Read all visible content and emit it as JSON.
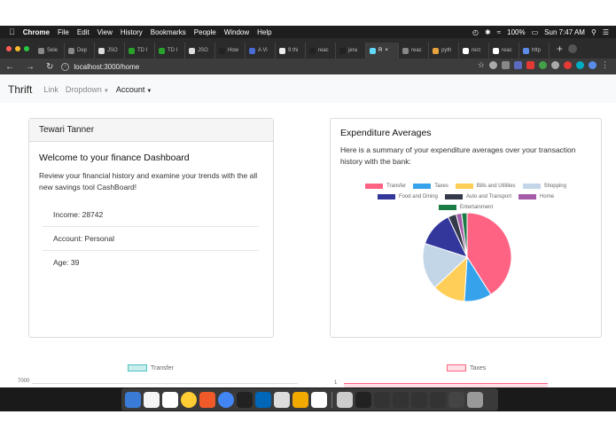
{
  "menubar": {
    "app": "Chrome",
    "items": [
      "File",
      "Edit",
      "View",
      "History",
      "Bookmarks",
      "People",
      "Window",
      "Help"
    ],
    "battery": "100%",
    "clock": "Sun 7:47 AM"
  },
  "tabs": [
    {
      "label": "Sele",
      "color": "#888888"
    },
    {
      "label": "Dep",
      "color": "#888888"
    },
    {
      "label": "JSO",
      "color": "#dddddd"
    },
    {
      "label": "TD I",
      "color": "#2aa12a"
    },
    {
      "label": "TD I",
      "color": "#2aa12a"
    },
    {
      "label": "JSO",
      "color": "#dddddd"
    },
    {
      "label": "How",
      "color": "#222222"
    },
    {
      "label": "A Vi",
      "color": "#4a6cd4"
    },
    {
      "label": "9 thi",
      "color": "#eeeeee"
    },
    {
      "label": "reac",
      "color": "#222222"
    },
    {
      "label": "jera",
      "color": "#222222"
    },
    {
      "label": "R",
      "color": "#61dafb",
      "active": true
    },
    {
      "label": "reac",
      "color": "#888888"
    },
    {
      "label": "pyth",
      "color": "#e8a33c"
    },
    {
      "label": "rect",
      "color": "#ffffff"
    },
    {
      "label": "reac",
      "color": "#ffffff"
    },
    {
      "label": "http",
      "color": "#5b8de8"
    }
  ],
  "address": {
    "url": "localhost:3000/home"
  },
  "navbar": {
    "brand": "Thrift",
    "links": [
      {
        "label": "Link"
      },
      {
        "label": "Dropdown"
      },
      {
        "label": "Account"
      }
    ]
  },
  "profile": {
    "name": "Tewari Tanner",
    "title": "Welcome to your finance Dashboard",
    "text": "Review your financial history and examine your trends with the all new savings tool CashBoard!",
    "items": [
      "Income: 28742",
      "Account: Personal",
      "Age: 39"
    ]
  },
  "expenditure": {
    "title": "Expenditure Averages",
    "text": "Here is a summary of your expenditure averages over your transaction history with the bank:"
  },
  "chart_data": [
    {
      "type": "pie",
      "legend": "top",
      "categories": [
        "Transfer",
        "Taxes",
        "Bills and Utilities",
        "Shopping",
        "Food and Dining",
        "Auto and Transport",
        "Home",
        "Entertainment"
      ],
      "values": [
        41,
        10,
        12,
        17,
        13,
        3,
        2,
        2
      ],
      "colors": [
        "#ff6384",
        "#36a2eb",
        "#ffce56",
        "#c3d6e7",
        "#33379c",
        "#353a4a",
        "#a55ca8",
        "#1a7b45"
      ]
    },
    {
      "type": "line",
      "series": [
        {
          "name": "Transfer"
        }
      ],
      "y_tick_top": "7000",
      "color": "#4bc0c0"
    },
    {
      "type": "line",
      "series": [
        {
          "name": "Taxes"
        }
      ],
      "y_tick_top": "1",
      "color": "#ff6384"
    }
  ],
  "dock": {
    "colors": [
      "#3a7bd5",
      "#f5f5f5",
      "#ffffff",
      "#ffcc33",
      "#f05a28",
      "#4285f4",
      "#222222",
      "#0066b8",
      "#dddddd",
      "#f2a900",
      "#ffffff",
      "#cccccc",
      "#222222",
      "#333333",
      "#333333",
      "#333333",
      "#333333",
      "#444444",
      "#999999"
    ]
  }
}
